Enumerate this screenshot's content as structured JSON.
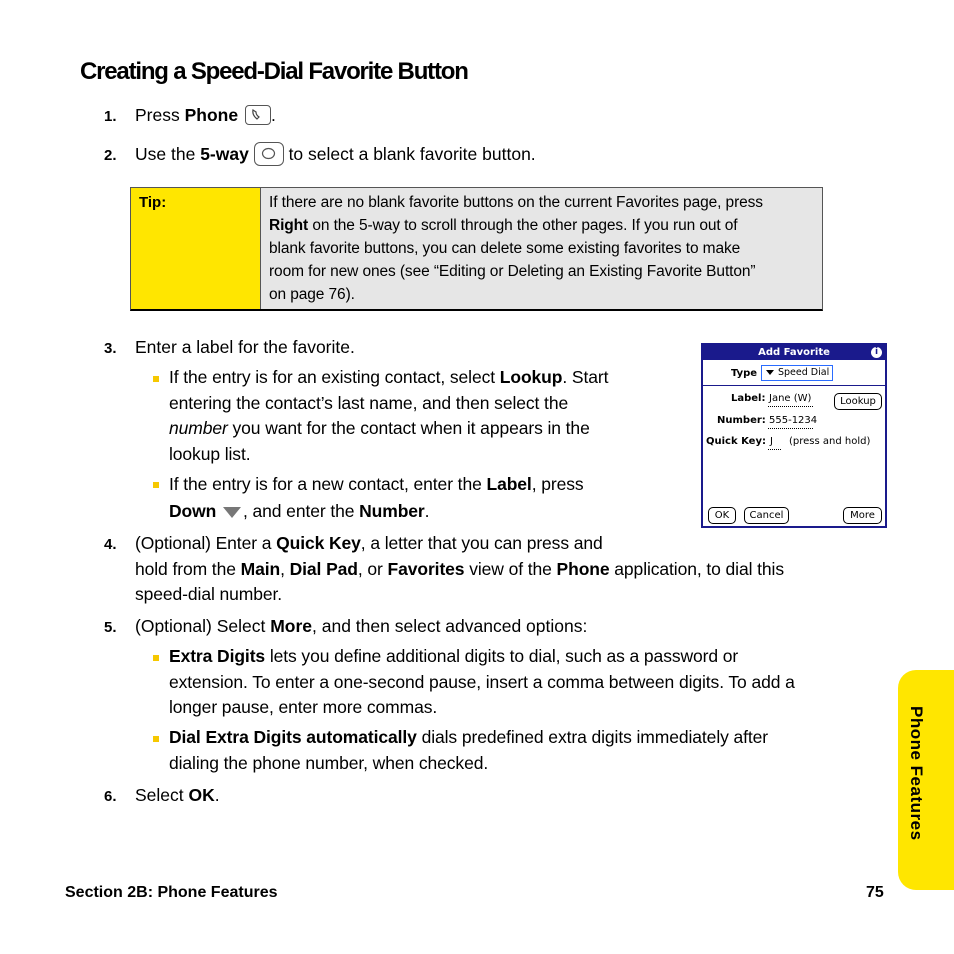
{
  "title": "Creating a Speed-Dial Favorite Button",
  "steps": {
    "s1": {
      "num": "1.",
      "pre": "Press ",
      "bold": "Phone",
      "post": "."
    },
    "s2": {
      "num": "2.",
      "pre": "Use the ",
      "bold": "5-way",
      "post": " to select a blank favorite button."
    },
    "s3": {
      "num": "3.",
      "text": "Enter a label for the favorite."
    },
    "s4": {
      "num": "4.",
      "t1": "(Optional) Enter a ",
      "b1": "Quick Key",
      "t2": ", a letter that you can press and",
      "t3": "hold from the ",
      "b2": "Main",
      "t4": ", ",
      "b3": "Dial Pad",
      "t5": ", or ",
      "b4": "Favorites",
      "t6": " view of the ",
      "b5": "Phone",
      "t7": " application, to dial this",
      "t8": "speed-dial number."
    },
    "s5": {
      "num": "5.",
      "t1": "(Optional) Select ",
      "b1": "More",
      "t2": ", and then select advanced options:"
    },
    "s6": {
      "num": "6.",
      "t1": "Select ",
      "b1": "OK",
      "t2": "."
    }
  },
  "tip": {
    "label": "Tip:",
    "l1": "If there are no blank favorite buttons on the current Favorites page, press",
    "l2b": "Right",
    "l2": " on the 5-way to scroll through the other pages. If you run out of",
    "l3": "blank favorite buttons, you can delete some existing favorites to make",
    "l4": "room for new ones (see “Editing or Deleting an Existing Favorite Button”",
    "l5": "on page 76)."
  },
  "bullets3": {
    "b1": {
      "t1": "If the entry is for an existing contact, select ",
      "b1": "Lookup",
      "t2": ". Start",
      "l2": "entering the contact’s last name, and then select the",
      "i1": "number",
      "l3": " you want for the contact when it appears in the",
      "l4": "lookup list."
    },
    "b2": {
      "t1": "If the entry is for a new contact, enter the ",
      "b1": "Label",
      "t2": ", press",
      "b2": "Down",
      "t3": ", and enter the ",
      "b3": "Number",
      "t4": "."
    }
  },
  "bullets5": {
    "b1": {
      "b1": "Extra Digits",
      "t1": " lets you define additional digits to dial, such as a password or",
      "l2": "extension. To enter a one-second pause, insert a comma between digits. To add a",
      "l3": "longer pause, enter more commas."
    },
    "b2": {
      "b1": "Dial Extra Digits automatically",
      "t1": " dials predefined extra digits immediately after",
      "l2": "dialing the phone number, when checked."
    }
  },
  "palm": {
    "title": "Add Favorite",
    "info": "i",
    "type_label": "Type",
    "type_value": "Speed Dial",
    "label_label": "Label:",
    "label_value": "Jane (W)",
    "lookup_button": "Lookup",
    "number_label": "Number:",
    "number_value": "555-1234",
    "quickkey_label": "Quick Key:",
    "quickkey_value": "J",
    "quickkey_hint": "(press and hold)",
    "ok_button": "OK",
    "cancel_button": "Cancel",
    "more_button": "More"
  },
  "sidetab": "Phone Features",
  "footer": {
    "section": "Section 2B: Phone Features",
    "page": "75"
  },
  "colors": {
    "accent_yellow": "#ffe600",
    "tip_gray": "#e6e6e6",
    "palm_blue": "#1a1a8c"
  }
}
